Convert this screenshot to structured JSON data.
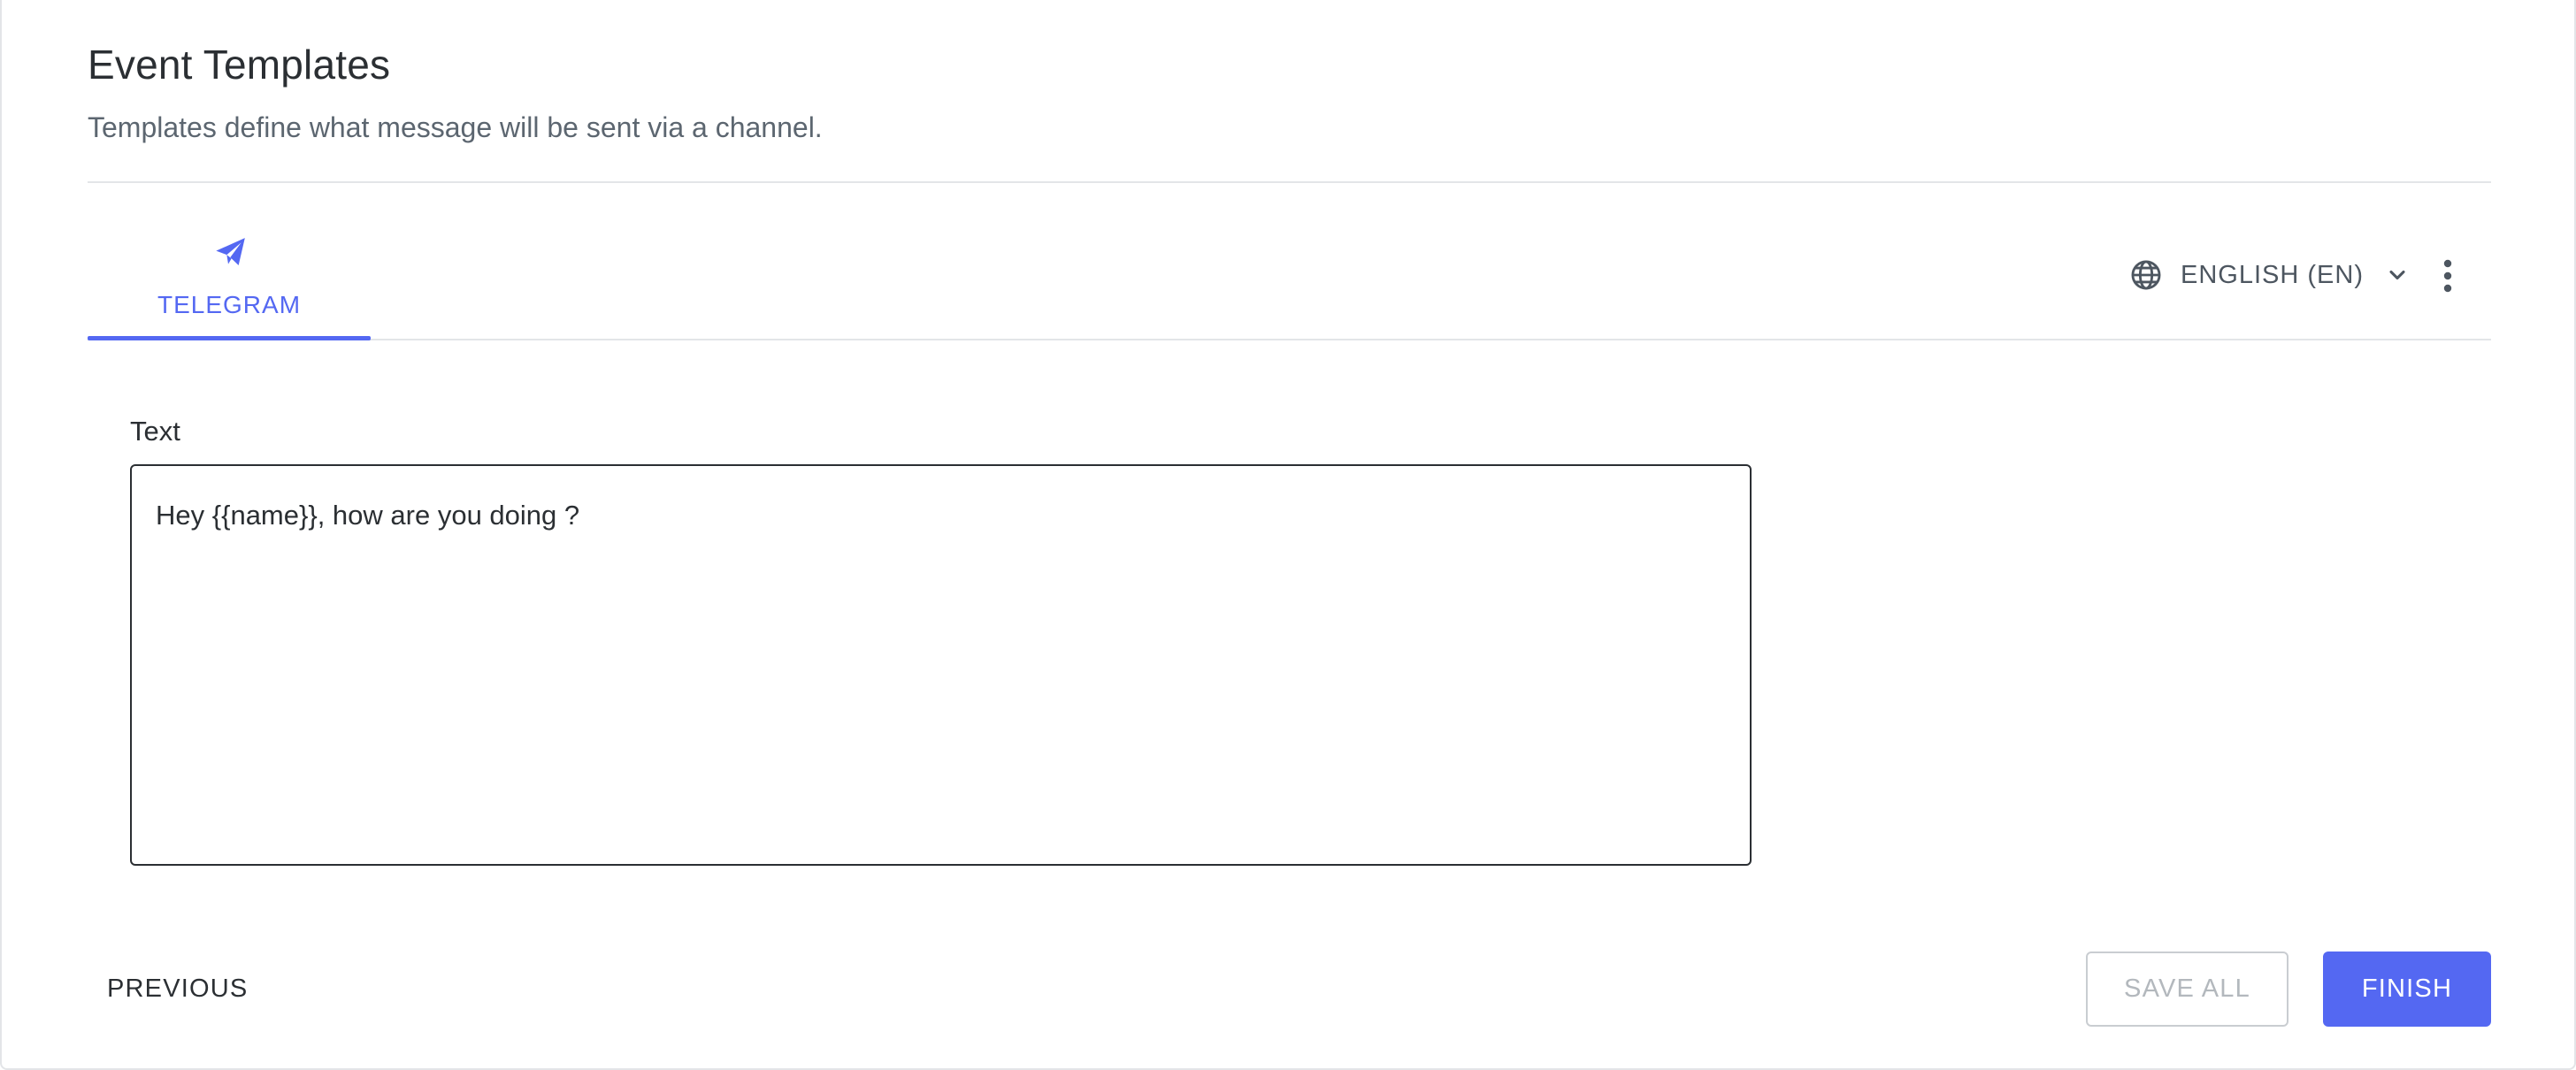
{
  "header": {
    "title": "Event Templates",
    "subtitle": "Templates define what message will be sent via a channel."
  },
  "tabs": [
    {
      "label": "TELEGRAM",
      "icon": "send-icon",
      "active": true
    }
  ],
  "language": {
    "icon": "globe-icon",
    "selected": "ENGLISH (EN)",
    "chevron_icon": "chevron-down-icon"
  },
  "menu": {
    "icon": "more-vertical-icon"
  },
  "form": {
    "text_label": "Text",
    "text_value": "Hey {{name}}, how are you doing ?"
  },
  "footer": {
    "previous_label": "PREVIOUS",
    "save_all_label": "SAVE ALL",
    "finish_label": "FINISH"
  },
  "colors": {
    "accent": "#5468f2",
    "text_primary": "#2b2f33",
    "text_secondary": "#5c6670",
    "disabled": "#b3b8bd",
    "divider": "#e3e5e8"
  }
}
